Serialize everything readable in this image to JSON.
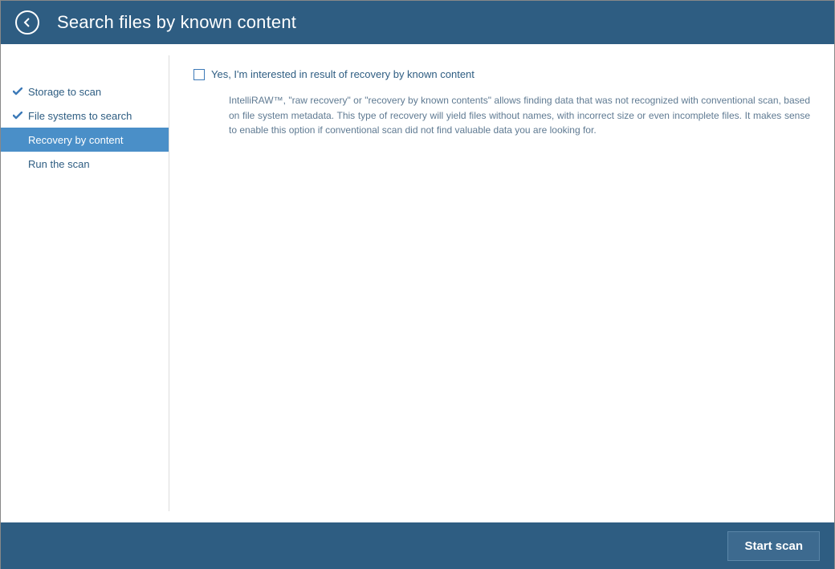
{
  "header": {
    "title": "Search files by known content"
  },
  "sidebar": {
    "items": [
      {
        "label": "Storage to scan",
        "checked": true,
        "active": false
      },
      {
        "label": "File systems to search",
        "checked": true,
        "active": false
      },
      {
        "label": "Recovery by content",
        "checked": false,
        "active": true
      },
      {
        "label": "Run the scan",
        "checked": false,
        "active": false
      }
    ]
  },
  "content": {
    "checkbox_label": "Yes, I'm interested in result of recovery by known content",
    "checkbox_checked": false,
    "description": "IntelliRAW™, \"raw recovery\" or \"recovery by known contents\" allows finding data that was not recognized with conventional scan, based on file system metadata. This type of recovery will yield files without names, with incorrect size or even incomplete files. It makes sense to enable this option if conventional scan did not find valuable data you are looking for."
  },
  "footer": {
    "start_label": "Start scan"
  }
}
